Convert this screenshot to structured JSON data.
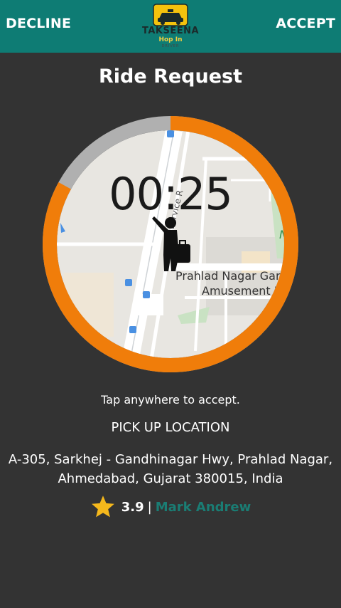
{
  "header": {
    "decline_label": "DECLINE",
    "accept_label": "ACCEPT",
    "logo": {
      "text": "TAKSEENA",
      "subtext": "Hop In",
      "tag": "DRIVER"
    }
  },
  "title": "Ride Request",
  "timer": {
    "display": "00:25",
    "remaining_fraction": 0.83
  },
  "map": {
    "place_label_line1": "Prahlad Nagar Gard",
    "place_label_line2": "Amusement P",
    "road_label": "Service R",
    "area_label": "Nag"
  },
  "hint": "Tap anywhere to accept.",
  "pickup": {
    "label": "PICK UP LOCATION",
    "address_line1": "A-305, Sarkhej - Gandhinagar Hwy, Prahlad Nagar,",
    "address_line2": "Ahmedabad, Gujarat 380015, India"
  },
  "rider": {
    "rating": "3.9",
    "separator": "|",
    "name": "Mark Andrew"
  },
  "colors": {
    "header_bg": "#0e7c74",
    "background": "#333333",
    "progress": "#f07d0a",
    "track": "#b0b0b0",
    "star": "#f5b81c",
    "name": "#1a7d74"
  }
}
